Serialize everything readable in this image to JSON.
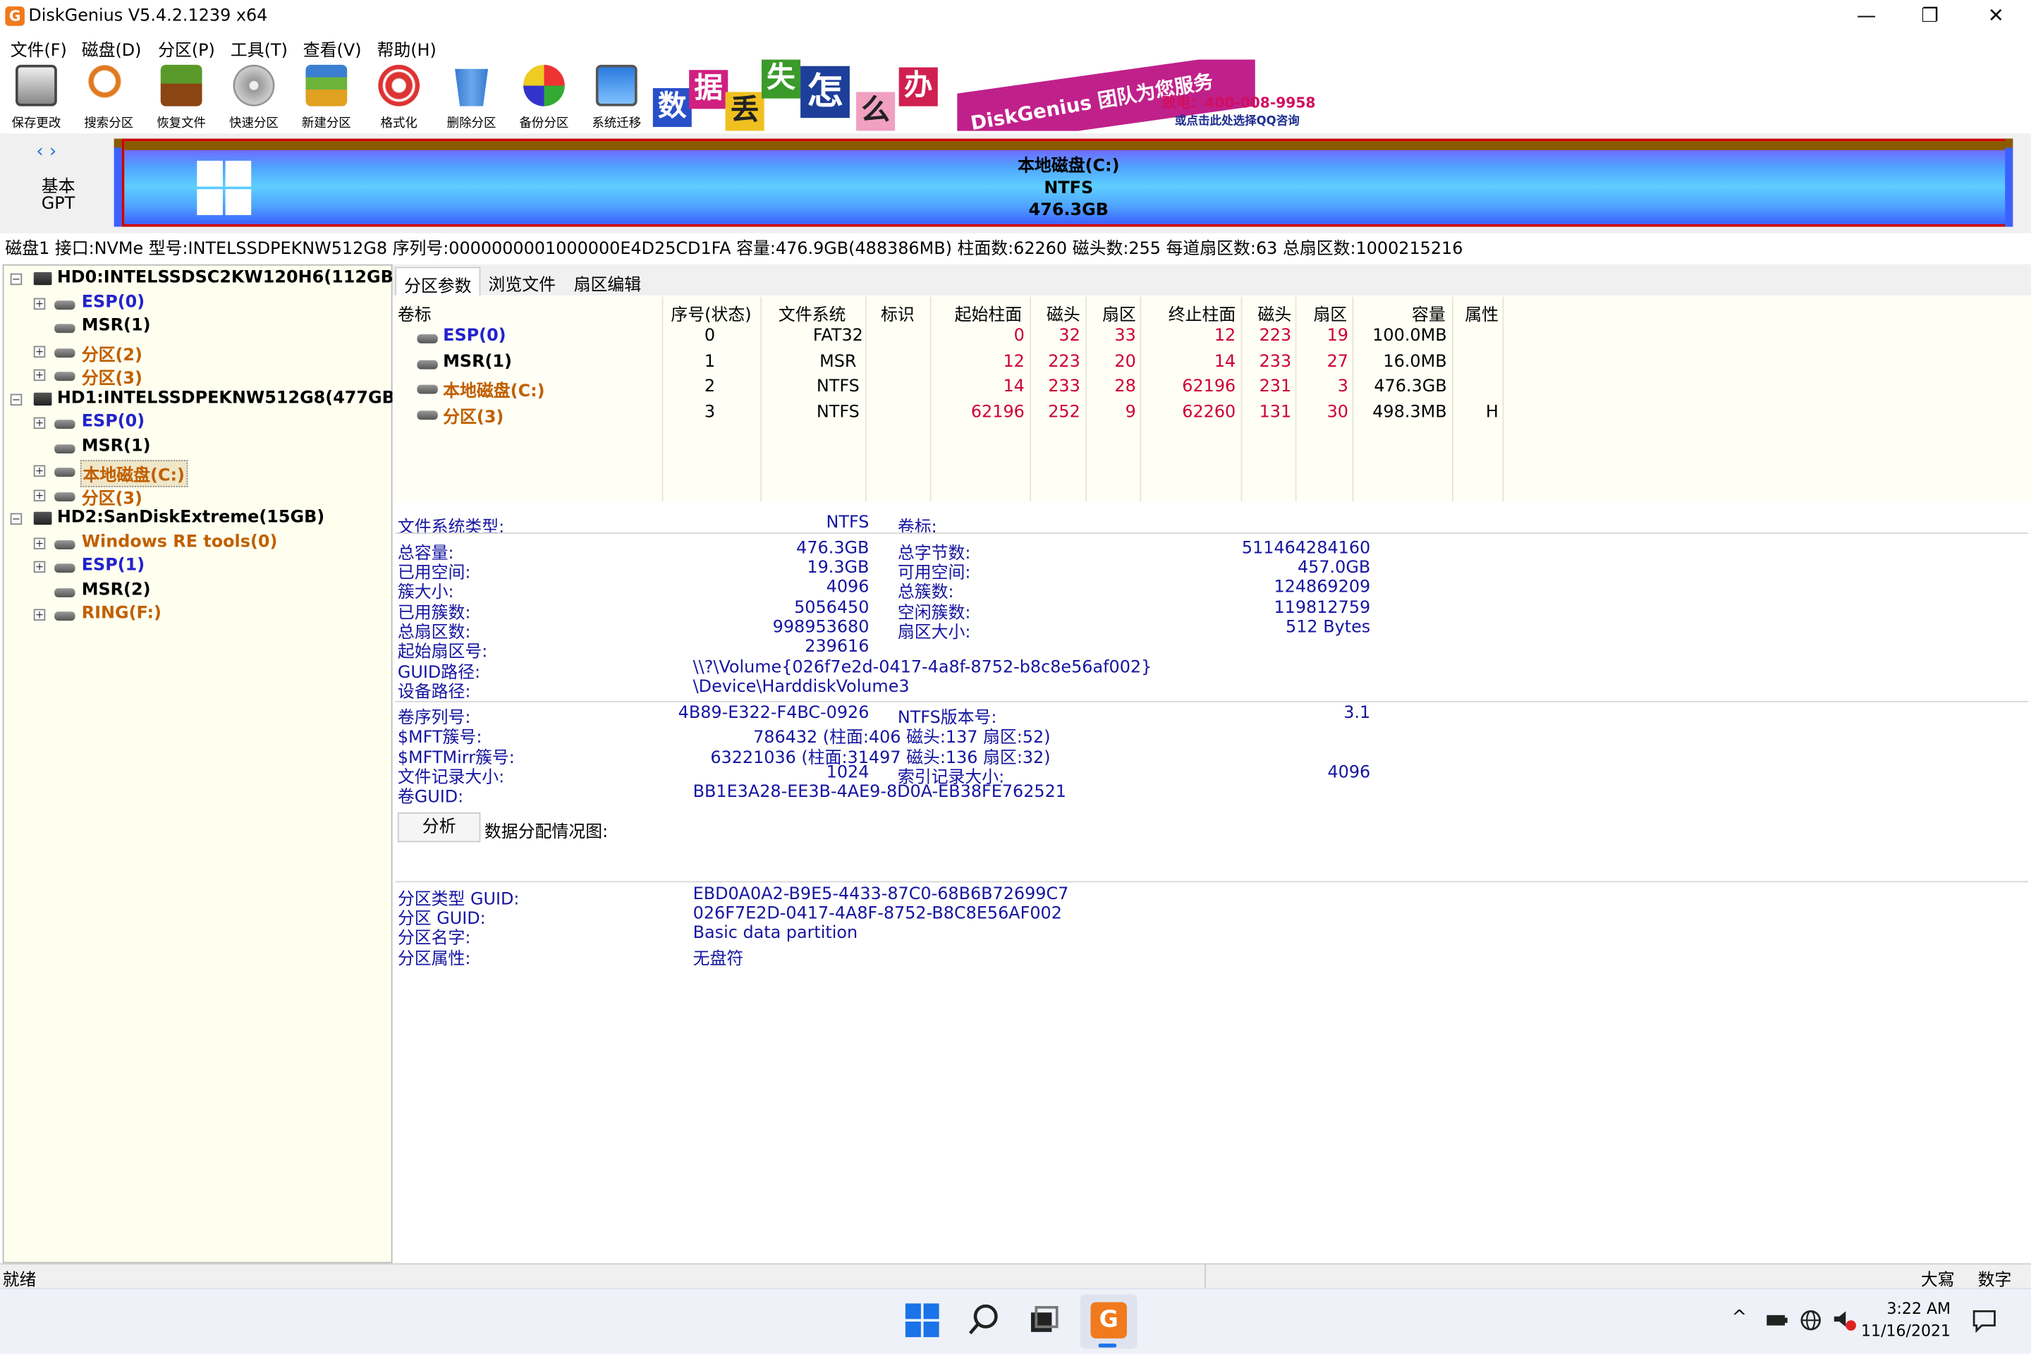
{
  "window": {
    "title": "DiskGenius V5.4.2.1239 x64",
    "icon_letter": "G",
    "min": "—",
    "max": "❐",
    "close": "✕"
  },
  "menu": [
    "文件(F)",
    "磁盘(D)",
    "分区(P)",
    "工具(T)",
    "查看(V)",
    "帮助(H)"
  ],
  "toolbar": [
    {
      "label": "保存更改",
      "icon": "save-icon"
    },
    {
      "label": "搜索分区",
      "icon": "search-icon"
    },
    {
      "label": "恢复文件",
      "icon": "recover-icon"
    },
    {
      "label": "快速分区",
      "icon": "quick-partition-icon"
    },
    {
      "label": "新建分区",
      "icon": "new-partition-icon"
    },
    {
      "label": "格式化",
      "icon": "format-icon"
    },
    {
      "label": "删除分区",
      "icon": "delete-icon"
    },
    {
      "label": "备份分区",
      "icon": "backup-icon"
    },
    {
      "label": "系统迁移",
      "icon": "migrate-icon"
    }
  ],
  "banner": {
    "chars": [
      "数",
      "据",
      "丢",
      "失",
      "怎",
      "么",
      "办"
    ],
    "slogan": "DiskGenius 团队为您服务",
    "phone": "致电：400-008-9958",
    "qq": "或点击此处选择QQ咨询"
  },
  "diskmap": {
    "nav": "‹ ›",
    "type": "基本",
    "scheme": "GPT",
    "partition_name": "本地磁盘(C:)",
    "partition_fs": "NTFS",
    "partition_size": "476.3GB"
  },
  "infoline": "磁盘1 接口:NVMe  型号:INTELSSDPEKNW512G8  序列号:0000000001000000E4D25CD1FA  容量:476.9GB(488386MB)  柱面数:62260  磁头数:255  每道扇区数:63  总扇区数:1000215216",
  "tree": {
    "disks": [
      {
        "name": "HD0:INTELSSDSC2KW120H6(112GB)",
        "partitions": [
          {
            "name": "ESP(0)",
            "color": "blue",
            "expand": true
          },
          {
            "name": "MSR(1)",
            "color": "black",
            "expand": false
          },
          {
            "name": "分区(2)",
            "color": "orange",
            "expand": true
          },
          {
            "name": "分区(3)",
            "color": "orange",
            "expand": true
          }
        ]
      },
      {
        "name": "HD1:INTELSSDPEKNW512G8(477GB)",
        "partitions": [
          {
            "name": "ESP(0)",
            "color": "blue",
            "expand": true
          },
          {
            "name": "MSR(1)",
            "color": "black",
            "expand": false
          },
          {
            "name": "本地磁盘(C:)",
            "color": "orange",
            "expand": true,
            "selected": true
          },
          {
            "name": "分区(3)",
            "color": "orange",
            "expand": true
          }
        ]
      },
      {
        "name": "HD2:SanDiskExtreme(15GB)",
        "partitions": [
          {
            "name": "Windows RE tools(0)",
            "color": "orange",
            "expand": true
          },
          {
            "name": "ESP(1)",
            "color": "blue",
            "expand": true
          },
          {
            "name": "MSR(2)",
            "color": "black",
            "expand": false
          },
          {
            "name": "RING(F:)",
            "color": "orange",
            "expand": true
          }
        ]
      }
    ],
    "plus": "+",
    "minus": "−"
  },
  "tabs": [
    "分区参数",
    "浏览文件",
    "扇区编辑"
  ],
  "table": {
    "headers": [
      "卷标",
      "序号(状态)",
      "文件系统",
      "标识",
      "起始柱面",
      "磁头",
      "扇区",
      "终止柱面",
      "磁头",
      "扇区",
      "容量",
      "属性"
    ],
    "rows": [
      {
        "name": "ESP(0)",
        "color": "blue",
        "index": "0",
        "fs": "FAT32",
        "id": "",
        "start_cyl": "0",
        "start_head": "32",
        "start_sec": "33",
        "end_cyl": "12",
        "end_head": "223",
        "end_sec": "19",
        "size": "100.0MB",
        "attr": ""
      },
      {
        "name": "MSR(1)",
        "color": "black",
        "index": "1",
        "fs": "MSR",
        "id": "",
        "start_cyl": "12",
        "start_head": "223",
        "start_sec": "20",
        "end_cyl": "14",
        "end_head": "233",
        "end_sec": "27",
        "size": "16.0MB",
        "attr": ""
      },
      {
        "name": "本地磁盘(C:)",
        "color": "orange",
        "index": "2",
        "fs": "NTFS",
        "id": "",
        "start_cyl": "14",
        "start_head": "233",
        "start_sec": "28",
        "end_cyl": "62196",
        "end_head": "231",
        "end_sec": "3",
        "size": "476.3GB",
        "attr": ""
      },
      {
        "name": "分区(3)",
        "color": "orange",
        "index": "3",
        "fs": "NTFS",
        "id": "",
        "start_cyl": "62196",
        "start_head": "252",
        "start_sec": "9",
        "end_cyl": "62260",
        "end_head": "131",
        "end_sec": "30",
        "size": "498.3MB",
        "attr": "H"
      }
    ]
  },
  "details": {
    "fs_type_label": "文件系统类型:",
    "fs_type": "NTFS",
    "vol_label_label": "卷标:",
    "total_label": "总容量:",
    "total": "476.3GB",
    "total_bytes_label": "总字节数:",
    "total_bytes": "511464284160",
    "used_label": "已用空间:",
    "used": "19.3GB",
    "free_label": "可用空间:",
    "free": "457.0GB",
    "cluster_label": "簇大小:",
    "cluster": "4096",
    "total_clusters_label": "总簇数:",
    "total_clusters": "124869209",
    "used_clusters_label": "已用簇数:",
    "used_clusters": "5056450",
    "free_clusters_label": "空闲簇数:",
    "free_clusters": "119812759",
    "total_sectors_label": "总扇区数:",
    "total_sectors": "998953680",
    "sector_size_label": "扇区大小:",
    "sector_size": "512 Bytes",
    "start_sector_label": "起始扇区号:",
    "start_sector": "239616",
    "guid_path_label": "GUID路径:",
    "guid_path": "\\\\?\\Volume{026f7e2d-0417-4a8f-8752-b8c8e56af002}",
    "device_path_label": "设备路径:",
    "device_path": "\\Device\\HarddiskVolume3",
    "serial_label": "卷序列号:",
    "serial": "4B89-E322-F4BC-0926",
    "ntfs_ver_label": "NTFS版本号:",
    "ntfs_ver": "3.1",
    "mft_label": "$MFT簇号:",
    "mft": "786432 (柱面:406 磁头:137 扇区:52)",
    "mftmirr_label": "$MFTMirr簇号:",
    "mftmirr": "63221036 (柱面:31497 磁头:136 扇区:32)",
    "record_label": "文件记录大小:",
    "record": "1024",
    "index_label": "索引记录大小:",
    "index": "4096",
    "volguid_label": "卷GUID:",
    "volguid": "BB1E3A28-EE3B-4AE9-8D0A-EB38FE762521",
    "analyze": "分析",
    "alloc_label": "数据分配情况图:",
    "ptype_guid_label": "分区类型 GUID:",
    "ptype_guid": "EBD0A0A2-B9E5-4433-87C0-68B6B72699C7",
    "pguid_label": "分区 GUID:",
    "pguid": "026F7E2D-0417-4A8F-8752-B8C8E56AF002",
    "pname_label": "分区名字:",
    "pname": "Basic data partition",
    "pattr_label": "分区属性:",
    "pattr": "无盘符"
  },
  "status": {
    "text": "就绪",
    "caps": "大寫",
    "num": "数字"
  },
  "taskbar": {
    "time": "3:22 AM",
    "date": "11/16/2021",
    "chevron": "^"
  }
}
